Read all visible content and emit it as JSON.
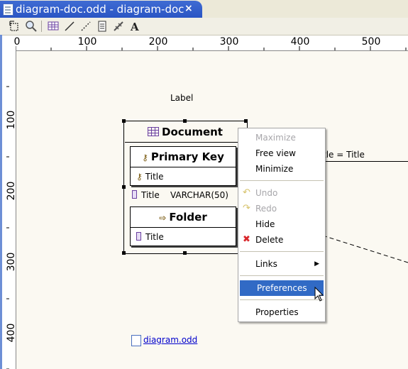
{
  "tab": {
    "title": "diagram-doc.odd - diagram-doc",
    "close": "×"
  },
  "toolbar": {
    "buttons": [
      "select-icon",
      "zoom-icon",
      "table-icon",
      "line-icon",
      "dashed-line-icon",
      "note-icon",
      "link-icon",
      "text-icon"
    ]
  },
  "ruler": {
    "h_labels": [
      "0",
      "100",
      "200",
      "300",
      "400",
      "500"
    ],
    "v_labels": [
      "100",
      "200",
      "300",
      "400"
    ]
  },
  "canvas": {
    "label": "Label",
    "document": {
      "title": "Document",
      "primary_key": {
        "title": "Primary Key",
        "field": "Title"
      },
      "attribute": {
        "name": "Title",
        "type": "VARCHAR(50)"
      },
      "folder": {
        "title": "Folder",
        "field": "Title"
      }
    },
    "edge_label": "tle = Title",
    "link_text": "diagram.odd"
  },
  "context_menu": {
    "items": [
      {
        "label": "Maximize",
        "enabled": false
      },
      {
        "label": "Free view",
        "enabled": true
      },
      {
        "label": "Minimize",
        "enabled": true
      },
      {
        "label": "Undo",
        "enabled": false,
        "icon": "undo-icon"
      },
      {
        "label": "Redo",
        "enabled": false,
        "icon": "redo-icon"
      },
      {
        "label": "Hide",
        "enabled": true
      },
      {
        "label": "Delete",
        "enabled": true,
        "icon": "delete-icon"
      },
      {
        "label": "Links",
        "enabled": true,
        "submenu": true
      },
      {
        "label": "Preferences",
        "enabled": true,
        "highlighted": true
      },
      {
        "label": "Properties",
        "enabled": true
      }
    ]
  },
  "colors": {
    "tab": "#2a55c4",
    "highlight": "#316ac5",
    "canvas": "#fbf9f2",
    "link": "#0000cc"
  }
}
